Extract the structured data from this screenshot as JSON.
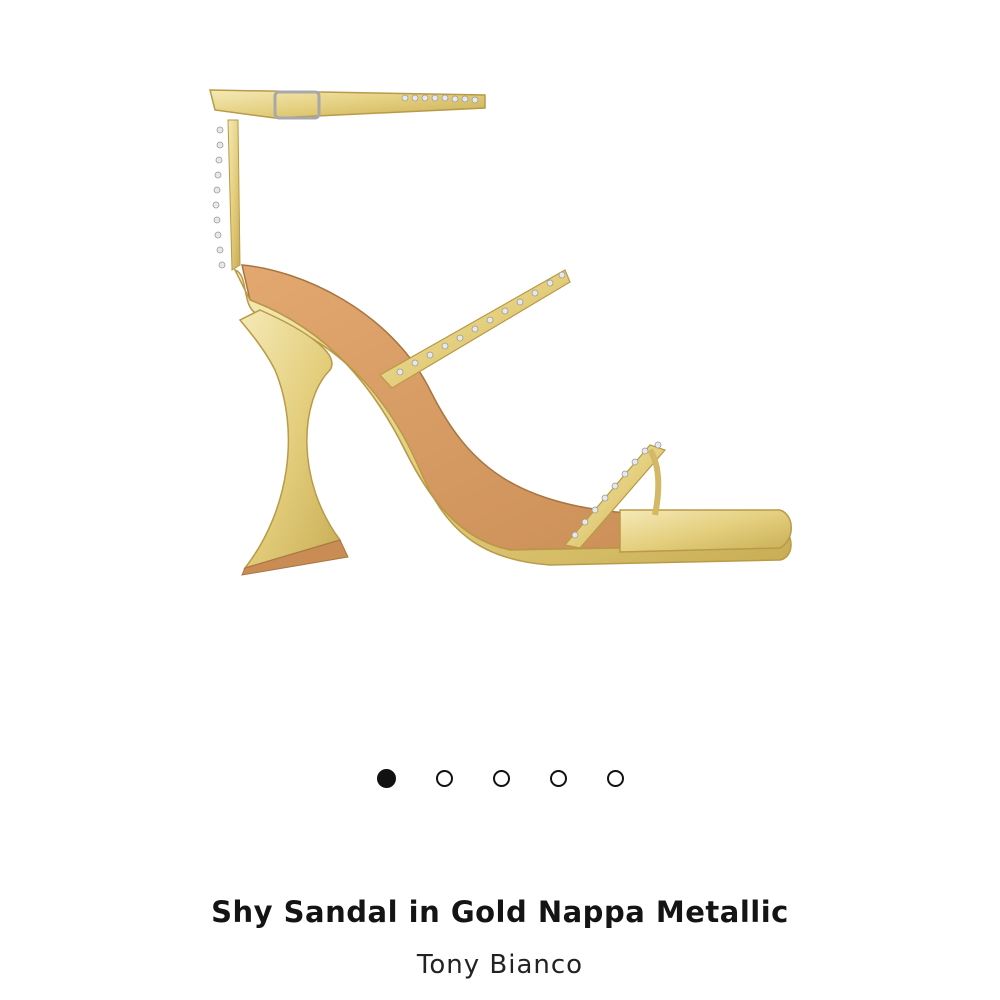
{
  "product": {
    "title": "Shy Sandal in Gold Nappa Metallic",
    "brand": "Tony Bianco",
    "image_subject": "gold-sandal-image"
  },
  "carousel": {
    "total_slides": 5,
    "active_index": 0
  }
}
